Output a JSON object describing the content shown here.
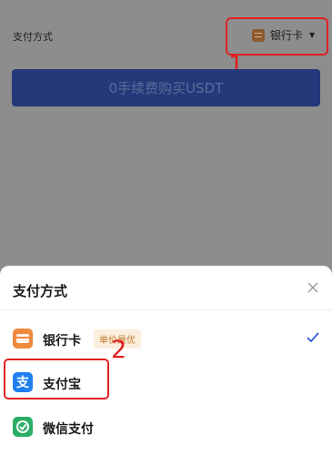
{
  "page": {
    "payment_label": "支付方式",
    "selected_method": "银行卡",
    "buy_button_label": "0手续费购买USDT"
  },
  "annotations": {
    "step1": "1",
    "step2": "2"
  },
  "sheet": {
    "title": "支付方式",
    "options": [
      {
        "label": "银行卡",
        "badge": "单价最优",
        "selected": true,
        "icon": "bank-card-icon"
      },
      {
        "label": "支付宝",
        "selected": false,
        "icon": "alipay-icon"
      },
      {
        "label": "微信支付",
        "selected": false,
        "icon": "wechat-pay-icon"
      }
    ]
  },
  "colors": {
    "overlay": "#8d8d8d",
    "button": "#24397a",
    "accent_check": "#2f5bd6",
    "annotation_red": "#e02020",
    "badge_text": "#c07b2a",
    "badge_bg": "#fbeedd"
  }
}
